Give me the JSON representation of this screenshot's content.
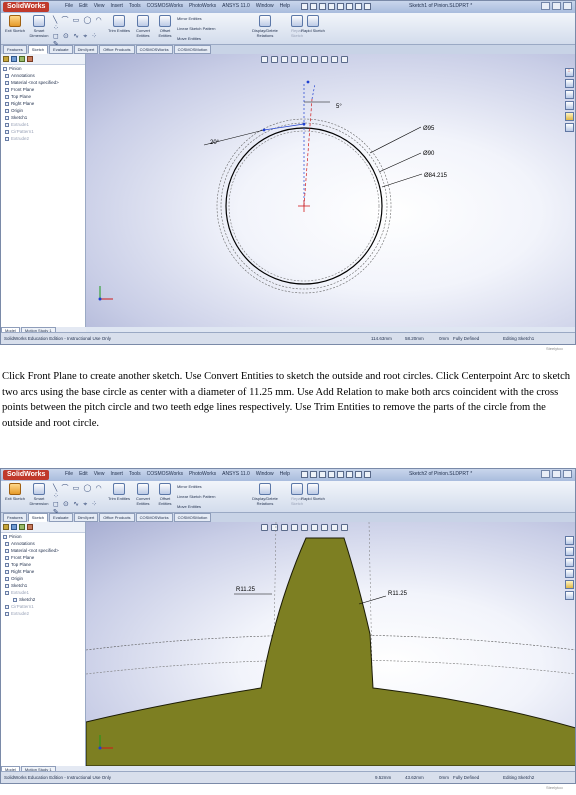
{
  "window1": {
    "logo": "SolidWorks",
    "menu": [
      "File",
      "Edit",
      "View",
      "Insert",
      "Tools",
      "COSMOSWorks",
      "PhotoWorks",
      "ANSYS 11.0",
      "Window",
      "Help"
    ],
    "doc_title": "Sketch1 of Pinion.SLDPRT *",
    "ribbon": {
      "exit": "Exit Sketch",
      "smart": "Smart Dimension",
      "trim": "Trim Entities",
      "convert": "Convert Entities",
      "offset": "Offset Entities",
      "mirror": "Mirror Entities",
      "linear": "Linear Sketch Pattern",
      "move": "Move Entities",
      "display": "Display/Delete Relations",
      "repair": "Repair Sketch",
      "rapid": "Rapid Sketch"
    },
    "tabs": [
      "Features",
      "Sketch",
      "Evaluate",
      "DimXpert",
      "Office Products",
      "COSMOSWorks",
      "COSMOSMotion"
    ],
    "tree": [
      {
        "label": "Pinion",
        "level": 0,
        "dim": false
      },
      {
        "label": "Annotations",
        "level": 1,
        "dim": false
      },
      {
        "label": "Material <not specified>",
        "level": 1,
        "dim": false
      },
      {
        "label": "Front Plane",
        "level": 1,
        "dim": false
      },
      {
        "label": "Top Plane",
        "level": 1,
        "dim": false
      },
      {
        "label": "Right Plane",
        "level": 1,
        "dim": false
      },
      {
        "label": "Origin",
        "level": 1,
        "dim": false
      },
      {
        "label": "Sketch1",
        "level": 1,
        "dim": false
      },
      {
        "label": "Extrude1",
        "level": 1,
        "dim": true
      },
      {
        "label": "CirPattern1",
        "level": 1,
        "dim": true
      },
      {
        "label": "Extrude2",
        "level": 1,
        "dim": true
      }
    ],
    "dims": {
      "d95": "Ø95",
      "d90": "Ø90",
      "d84": "Ø84.215",
      "angle5": "5°",
      "angle20": "20°"
    },
    "bottom_tabs": [
      "Model",
      "Motion Study 1"
    ],
    "status": {
      "left": "SolidWorks Education Edition - Instructional Use Only",
      "x": "114.63mm",
      "y": "58.20mm",
      "z": "0mm",
      "state": "Fully Defined",
      "editing": "Editing Sketch1"
    },
    "watermark": "Steelytoo"
  },
  "caption": "Click Front Plane to create another sketch. Use Convert Entities to sketch the outside and root circles. Click Centerpoint Arc to sketch two arcs using the base circle as center with a diameter of 11.25 mm. Use Add Relation to make both arcs coincident with the cross points between the pitch circle and two teeth edge lines respectively. Use Trim Entities to remove the parts of the circle from the outside and root circle.",
  "window2": {
    "logo": "SolidWorks",
    "menu": [
      "File",
      "Edit",
      "View",
      "Insert",
      "Tools",
      "COSMOSWorks",
      "PhotoWorks",
      "ANSYS 11.0",
      "Window",
      "Help"
    ],
    "doc_title": "Sketch2 of Pinion.SLDPRT *",
    "ribbon": {
      "exit": "Exit Sketch",
      "smart": "Smart Dimension",
      "trim": "Trim Entities",
      "convert": "Convert Entities",
      "offset": "Offset Entities",
      "mirror": "Mirror Entities",
      "linear": "Linear Sketch Pattern",
      "move": "Move Entities",
      "display": "Display/Delete Relations",
      "repair": "Repair Sketch",
      "rapid": "Rapid Sketch"
    },
    "tabs": [
      "Features",
      "Sketch",
      "Evaluate",
      "DimXpert",
      "Office Products",
      "COSMOSWorks",
      "COSMOSMotion"
    ],
    "tree": [
      {
        "label": "Pinion",
        "level": 0,
        "dim": false
      },
      {
        "label": "Annotations",
        "level": 1,
        "dim": false
      },
      {
        "label": "Material <not specified>",
        "level": 1,
        "dim": false
      },
      {
        "label": "Front Plane",
        "level": 1,
        "dim": false
      },
      {
        "label": "Top Plane",
        "level": 1,
        "dim": false
      },
      {
        "label": "Right Plane",
        "level": 1,
        "dim": false
      },
      {
        "label": "Origin",
        "level": 1,
        "dim": false
      },
      {
        "label": "Sketch1",
        "level": 1,
        "dim": false
      },
      {
        "label": "Extrude1",
        "level": 1,
        "dim": true
      },
      {
        "label": "Sketch2",
        "level": 2,
        "dim": false
      },
      {
        "label": "CirPattern1",
        "level": 1,
        "dim": true
      },
      {
        "label": "Extrude2",
        "level": 1,
        "dim": true
      }
    ],
    "dims": {
      "r_left": "R11.25",
      "r_right": "R11.25"
    },
    "bottom_tabs": [
      "Model",
      "Motion Study 1"
    ],
    "status": {
      "left": "SolidWorks Education Edition - Instructional Use Only",
      "x": "9.52mm",
      "y": "43.62mm",
      "z": "0mm",
      "state": "Fully Defined",
      "editing": "Editing Sketch2"
    },
    "watermark": "Steelytoo"
  },
  "colors": {
    "tooth_fill": "#7d7f22",
    "sketch_line": "#000000",
    "blue_point": "#1f3fd0",
    "origin_red": "#d01818",
    "viewport_light": "#ffffff",
    "viewport_dark": "#a7aed2"
  }
}
